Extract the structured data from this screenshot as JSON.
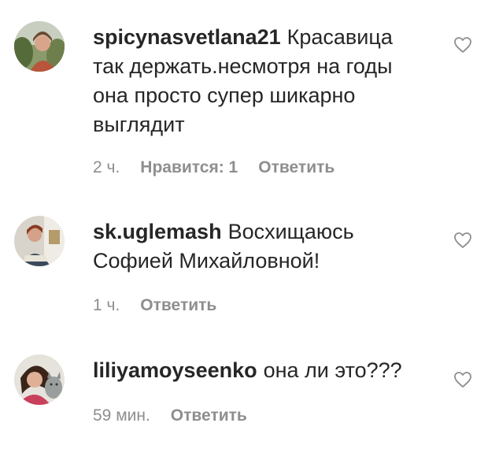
{
  "comments": [
    {
      "username": "spicynasvetlana21",
      "text": "Красавица так держать.несмотря на годы она просто супер шикарно выглядит",
      "time": "2 ч.",
      "likes": "Нравится: 1",
      "reply": "Ответить",
      "avatar_icon": "user-avatar-photo",
      "like_icon": "heart-outline-icon"
    },
    {
      "username": "sk.uglemash",
      "text": "Восхищаюсь Софией Михайловной!",
      "time": "1 ч.",
      "reply": "Ответить",
      "avatar_icon": "user-avatar-photo",
      "like_icon": "heart-outline-icon"
    },
    {
      "username": "liliyamoyseenko",
      "text": "она ли это???",
      "time": "59 мин.",
      "reply": "Ответить",
      "avatar_icon": "user-avatar-photo",
      "like_icon": "heart-outline-icon"
    }
  ],
  "colors": {
    "text": "#262626",
    "secondary": "#8e8e8e",
    "background": "#ffffff"
  }
}
